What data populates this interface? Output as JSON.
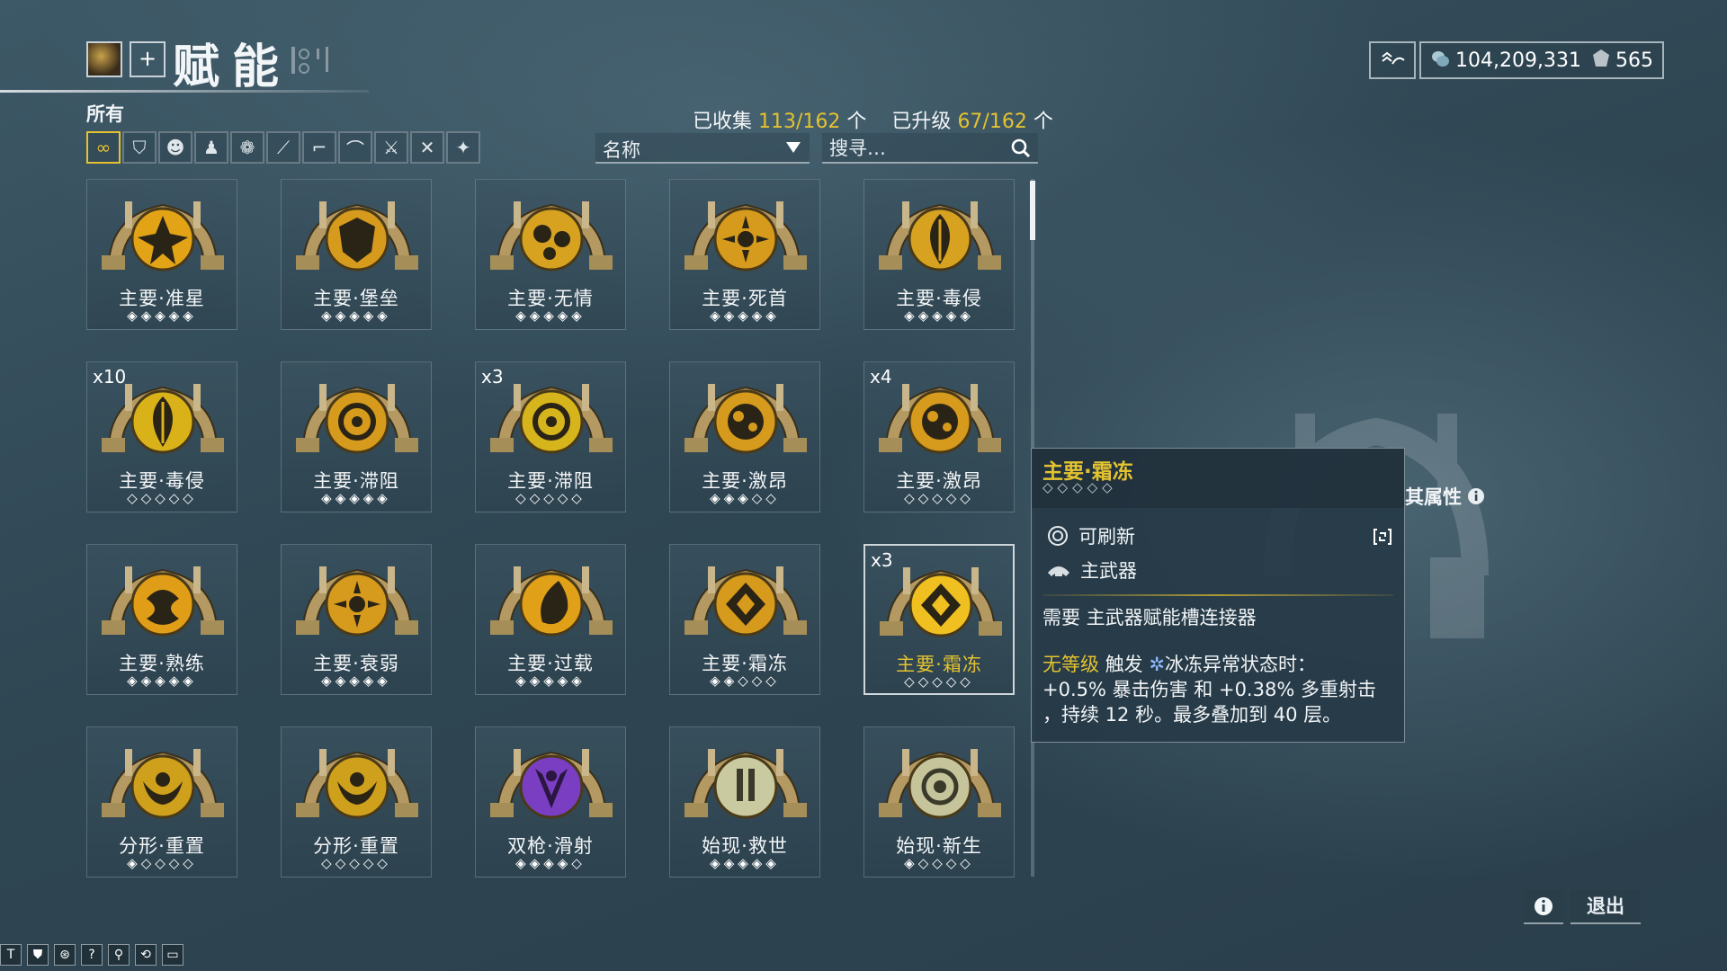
{
  "header": {
    "title": "赋能",
    "add_label": "+"
  },
  "currency": {
    "credits": "104,209,331",
    "endo": "565",
    "credit_icon": "credits-icon",
    "endo_icon": "endo-icon"
  },
  "filters": {
    "label": "所有",
    "items": [
      "infinity-icon",
      "warframe-icon",
      "operator-icon",
      "companion-icon",
      "flower-icon",
      "rifle-icon",
      "pistol-icon",
      "archwing-icon",
      "melee-icon",
      "crossed-swords-icon",
      "misc-icon"
    ]
  },
  "stats": {
    "collected_label": "已收集",
    "collected": "113/162",
    "unit": "个",
    "upgraded_label": "已升级",
    "upgraded": "67/162"
  },
  "sort": {
    "label": "名称"
  },
  "search": {
    "placeholder": "搜寻…"
  },
  "arcanes": [
    {
      "name": "主要·准星",
      "rank": "◈◈◈◈◈",
      "qty": "",
      "color": "#e2a317",
      "glyph": "star"
    },
    {
      "name": "主要·堡垒",
      "rank": "◈◈◈◈◈",
      "qty": "",
      "color": "#d69a1c",
      "glyph": "shield"
    },
    {
      "name": "主要·无情",
      "rank": "◈◈◈◈◈",
      "qty": "",
      "color": "#d6a21f",
      "glyph": "circles"
    },
    {
      "name": "主要·死首",
      "rank": "◈◈◈◈◈",
      "qty": "",
      "color": "#d69a1c",
      "glyph": "flower"
    },
    {
      "name": "主要·毒侵",
      "rank": "◈◈◈◈◈",
      "qty": "",
      "color": "#d6a21f",
      "glyph": "leaf"
    },
    {
      "name": "主要·毒侵",
      "rank": "◇◇◇◇◇",
      "qty": "x10",
      "color": "#d9b21a",
      "glyph": "leaf"
    },
    {
      "name": "主要·滞阻",
      "rank": "◈◈◈◈◈",
      "qty": "",
      "color": "#d69a1c",
      "glyph": "ring"
    },
    {
      "name": "主要·滞阻",
      "rank": "◇◇◇◇◇",
      "qty": "x3",
      "color": "#d6b41c",
      "glyph": "ring"
    },
    {
      "name": "主要·激昂",
      "rank": "◈◈◈◇◇",
      "qty": "",
      "color": "#d69a1c",
      "glyph": "yin"
    },
    {
      "name": "主要·激昂",
      "rank": "◇◇◇◇◇",
      "qty": "x4",
      "color": "#d69a1c",
      "glyph": "yin"
    },
    {
      "name": "主要·熟练",
      "rank": "◈◈◈◈◈",
      "qty": "",
      "color": "#e09d18",
      "glyph": "swirl"
    },
    {
      "name": "主要·衰弱",
      "rank": "◈◈◈◈◈",
      "qty": "",
      "color": "#d69a1c",
      "glyph": "flower"
    },
    {
      "name": "主要·过载",
      "rank": "◈◈◈◈◈",
      "qty": "",
      "color": "#e0a018",
      "glyph": "drop"
    },
    {
      "name": "主要·霜冻",
      "rank": "◈◈◇◇◇",
      "qty": "",
      "color": "#d69a1c",
      "glyph": "diamond"
    },
    {
      "name": "主要·霜冻",
      "rank": "◇◇◇◇◇",
      "qty": "x3",
      "color": "#f0c020",
      "glyph": "diamond",
      "selected": true
    },
    {
      "name": "分形·重置",
      "rank": "◈◇◇◇◇",
      "qty": "",
      "color": "#cfa01c",
      "glyph": "arc"
    },
    {
      "name": "分形·重置",
      "rank": "◇◇◇◇◇",
      "qty": "",
      "color": "#cfa01c",
      "glyph": "arc"
    },
    {
      "name": "双枪·滑射",
      "rank": "◈◈◈◈◇",
      "qty": "",
      "color": "#7a3ec2",
      "glyph": "claw"
    },
    {
      "name": "始现·救世",
      "rank": "◈◈◈◈◈",
      "qty": "",
      "color": "#c9caa0",
      "glyph": "bars"
    },
    {
      "name": "始现·新生",
      "rank": "◈◇◇◇◇",
      "qty": "",
      "color": "#c5c49a",
      "glyph": "target"
    }
  ],
  "tooltip": {
    "title": "主要·霜冻",
    "rank": "◇◇◇◇◇",
    "refreshable": "可刷新",
    "weapon": "主武器",
    "requirement": "需要 主武器赋能槽连接器",
    "level": "无等级",
    "trigger": "触发",
    "status": "冰冻异常状态时：",
    "line2": "+0.5% 暴击伤害 和 +0.38% 多重射击",
    "line3": "，持续 12 秒。最多叠加到 40 层。"
  },
  "attributes_label": "其属性",
  "footer": {
    "exit": "退出",
    "info": "i"
  },
  "taskbar": [
    "T",
    "⛊",
    "⊛",
    "?",
    "⚲",
    "⟲",
    "▭"
  ]
}
